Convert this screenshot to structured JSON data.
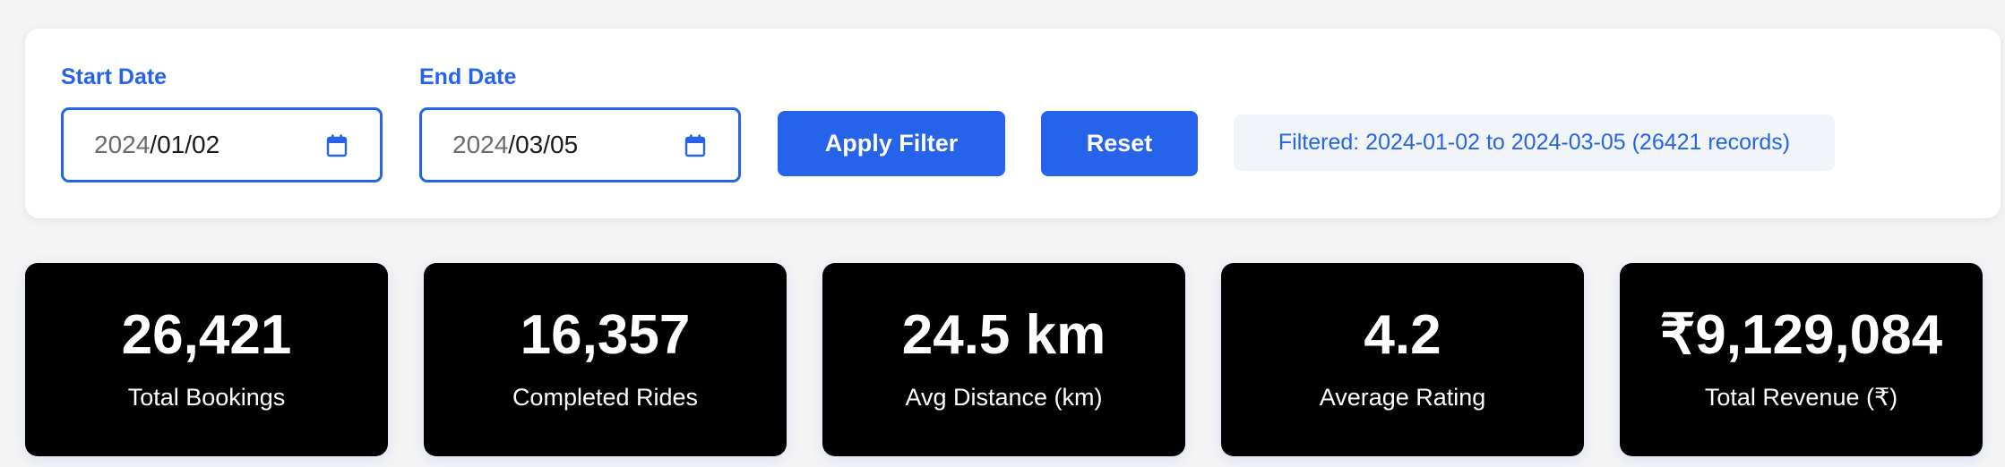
{
  "filter": {
    "start_label": "Start Date",
    "start_year": "2024",
    "start_rest": "/01/02",
    "end_label": "End Date",
    "end_year": "2024",
    "end_rest": "/03/05",
    "apply_label": "Apply Filter",
    "reset_label": "Reset",
    "status": "Filtered: 2024-01-02 to 2024-03-05 (26421 records)",
    "icon": "calendar-icon"
  },
  "stats": [
    {
      "value": "26,421",
      "label": "Total Bookings"
    },
    {
      "value": "16,357",
      "label": "Completed Rides"
    },
    {
      "value": "24.5 km",
      "label": "Avg Distance (km)"
    },
    {
      "value": "4.2",
      "label": "Average Rating"
    },
    {
      "value": "₹9,129,084",
      "label": "Total Revenue (₹)"
    }
  ],
  "colors": {
    "accent": "#2563eb",
    "card_bg": "#000000",
    "page_bg": "#f4f4f5",
    "status_bg": "#f1f5f9"
  }
}
